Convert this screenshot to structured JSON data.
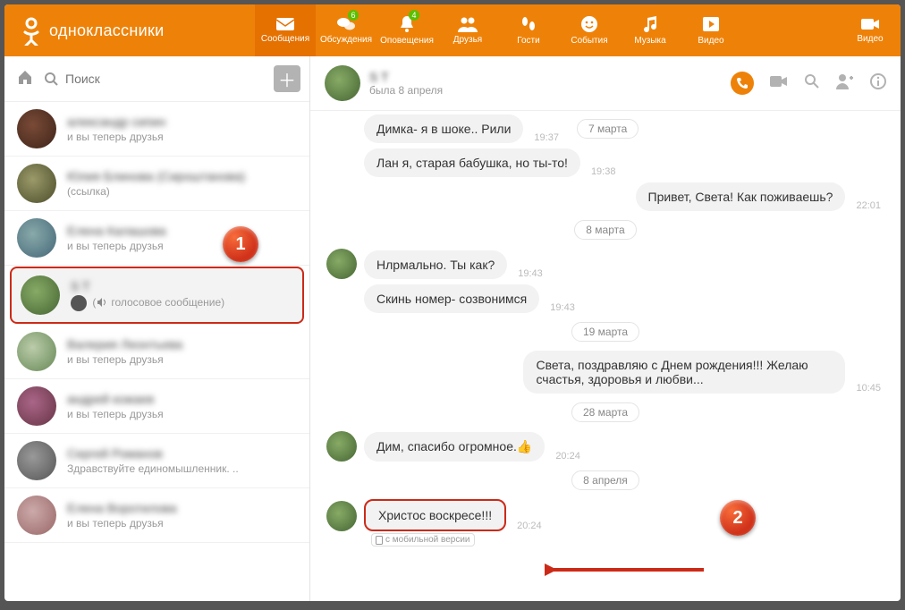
{
  "header": {
    "brand": "одноклассники",
    "nav": [
      {
        "label": "Сообщения"
      },
      {
        "label": "Обсуждения",
        "badge": "6"
      },
      {
        "label": "Оповещения",
        "badge": "4"
      },
      {
        "label": "Друзья"
      },
      {
        "label": "Гости"
      },
      {
        "label": "События"
      },
      {
        "label": "Музыка"
      },
      {
        "label": "Видео"
      }
    ],
    "nav_last": {
      "label": "Видео"
    }
  },
  "sidebar": {
    "search_placeholder": "Поиск",
    "contacts": [
      {
        "name": "александр сипин",
        "sub": "и вы теперь друзья"
      },
      {
        "name": "Юлия Блинова (Сироштанова)",
        "sub": "(ссылка)"
      },
      {
        "name": "Елена Калашова",
        "sub": "и вы теперь друзья"
      },
      {
        "name": "S T",
        "sub": "голосовое сообщение)"
      },
      {
        "name": "Валерия Леонтьева",
        "sub": "и вы теперь друзья"
      },
      {
        "name": "андрей кожаев",
        "sub": "и вы теперь друзья"
      },
      {
        "name": "Сергей Романов",
        "sub": "Здравствуйте единомышленник. .."
      },
      {
        "name": "Елена Воротилова",
        "sub": "и вы теперь друзья"
      }
    ]
  },
  "chat": {
    "name": "S T",
    "status": "была 8 апреля",
    "stream": {
      "m1": {
        "text": "Димка- я в шоке.. Рили",
        "time": "19:37"
      },
      "d1": "7 марта",
      "m2": {
        "text": "Лан я, старая бабушка, но ты-то!",
        "time": "19:38"
      },
      "m3": {
        "text": "Привет, Света! Как поживаешь?",
        "time": "22:01"
      },
      "d2": "8 марта",
      "m4": {
        "text": "Нлрмально. Ты как?",
        "time": "19:43"
      },
      "m5": {
        "text": "Скинь номер- созвонимся",
        "time": "19:43"
      },
      "d3": "19 марта",
      "m6": {
        "text": "Света, поздравляю с Днем рождения!!! Желаю счастья, здоровья и любви...",
        "time": "10:45"
      },
      "d4": "28 марта",
      "m7": {
        "text": "Дим, спасибо огромное.",
        "time": "20:24"
      },
      "d5": "8 апреля",
      "m8": {
        "text": "Христос воскресе!!!",
        "time": "20:24"
      },
      "mobile": "с мобильной версии"
    }
  },
  "callouts": {
    "c1": "1",
    "c2": "2"
  }
}
